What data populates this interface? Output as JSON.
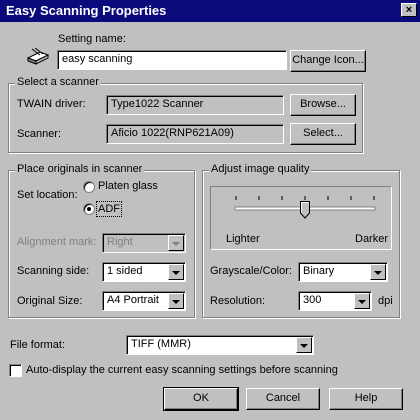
{
  "window": {
    "title": "Easy Scanning Properties",
    "close_glyph": "×"
  },
  "setting": {
    "label": "Setting name:",
    "value": "easy scanning",
    "change_icon_button": "Change Icon..."
  },
  "scanner_group": {
    "title": "Select a scanner",
    "twain_label": "TWAIN driver:",
    "twain_value": "Type1022 Scanner",
    "browse_button": "Browse...",
    "scanner_label": "Scanner:",
    "scanner_value": "Aficio 1022(RNP621A09)",
    "select_button": "Select..."
  },
  "place_group": {
    "title": "Place originals in scanner",
    "set_location_label": "Set location:",
    "options": [
      {
        "label": "Platen glass",
        "checked": false
      },
      {
        "label": "ADF",
        "checked": true
      }
    ],
    "alignment_label": "Alignment mark:",
    "alignment_value": "Right",
    "side_label": "Scanning side:",
    "side_value": "1 sided",
    "size_label": "Original Size:",
    "size_value": "A4 Portrait"
  },
  "quality_group": {
    "title": "Adjust image quality",
    "slider_level": 0.5,
    "lighter_label": "Lighter",
    "darker_label": "Darker",
    "grayscale_label": "Grayscale/Color:",
    "grayscale_value": "Binary",
    "resolution_label": "Resolution:",
    "resolution_value": "300",
    "resolution_unit": "dpi"
  },
  "file_format": {
    "label": "File format:",
    "value": "TIFF (MMR)"
  },
  "autodisplay": {
    "label": "Auto-display the current easy scanning settings before scanning",
    "checked": false
  },
  "buttons": {
    "ok": "OK",
    "cancel": "Cancel",
    "help": "Help"
  },
  "colors": {
    "title_bar": "#0a0a7c",
    "face": "#c0c0c0"
  }
}
